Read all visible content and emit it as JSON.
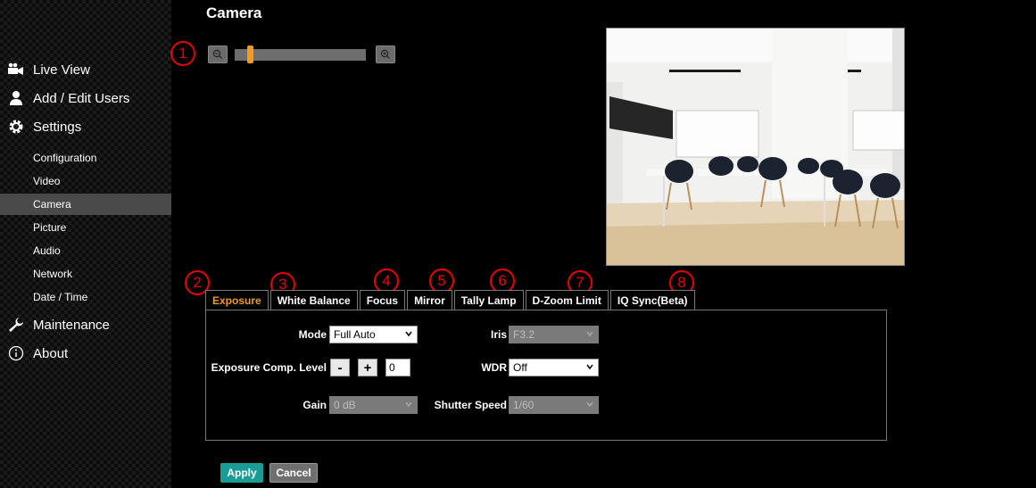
{
  "page": {
    "title": "Camera"
  },
  "sidebar": {
    "main": [
      {
        "label": "Live View",
        "icon": "video-camera-icon"
      },
      {
        "label": "Add / Edit Users",
        "icon": "user-icon"
      },
      {
        "label": "Settings",
        "icon": "gear-icon"
      }
    ],
    "sub": [
      {
        "label": "Configuration"
      },
      {
        "label": "Video"
      },
      {
        "label": "Camera",
        "active": true
      },
      {
        "label": "Picture"
      },
      {
        "label": "Audio"
      },
      {
        "label": "Network"
      },
      {
        "label": "Date / Time"
      }
    ],
    "bottom": [
      {
        "label": "Maintenance",
        "icon": "wrench-icon"
      },
      {
        "label": "About",
        "icon": "info-icon"
      }
    ]
  },
  "zoom": {
    "level_fraction": 0.1
  },
  "markers": [
    "1",
    "2",
    "3",
    "4",
    "5",
    "6",
    "7",
    "8"
  ],
  "tabs": [
    "Exposure",
    "White Balance",
    "Focus",
    "Mirror",
    "Tally Lamp",
    "D-Zoom Limit",
    "IQ Sync(Beta)"
  ],
  "active_tab": "Exposure",
  "exposure": {
    "mode_label": "Mode",
    "mode_value": "Full Auto",
    "comp_label": "Exposure Comp. Level",
    "comp_minus": "-",
    "comp_plus": "+",
    "comp_value": "0",
    "gain_label": "Gain",
    "gain_value": "0 dB",
    "iris_label": "Iris",
    "iris_value": "F3.2",
    "wdr_label": "WDR",
    "wdr_value": "Off",
    "shutter_label": "Shutter Speed",
    "shutter_value": "1/60"
  },
  "actions": {
    "apply": "Apply",
    "cancel": "Cancel"
  },
  "colors": {
    "accent": "#f39b1a",
    "apply_bg": "#1a9c96",
    "marker": "#ee0000"
  }
}
